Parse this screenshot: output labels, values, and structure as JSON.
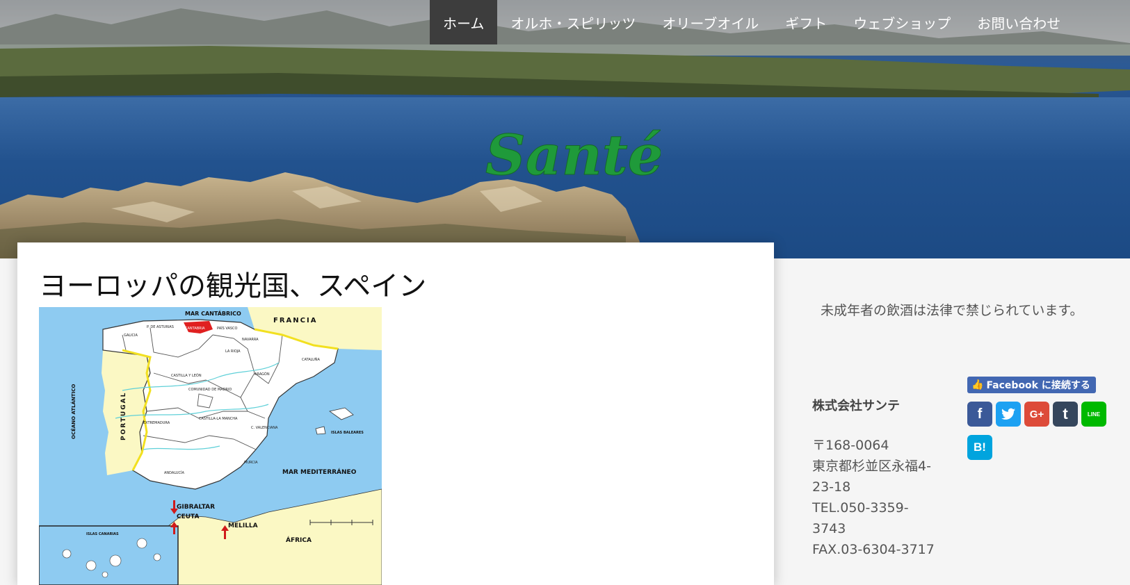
{
  "nav": {
    "items": [
      {
        "label": "ホーム",
        "active": true
      },
      {
        "label": "オルホ・スピリッツ",
        "active": false
      },
      {
        "label": "オリーブオイル",
        "active": false
      },
      {
        "label": "ギフト",
        "active": false
      },
      {
        "label": "ウェブショップ",
        "active": false
      },
      {
        "label": "お問い合わせ",
        "active": false
      }
    ]
  },
  "header": {
    "logo_text": "Santé",
    "logo_color": "#1f9a3a"
  },
  "article": {
    "title": "ヨーロッパの観光国、スペイン",
    "map_labels": {
      "sea_north": "MAR CANTÁBRICO",
      "france": "FRANCIA",
      "portugal": "PORTUGAL",
      "atlantic": "OCÉANO ATLÁNTICO",
      "mediterranean": "MAR MEDITERRÁNEO",
      "gibraltar": "GIBRALTAR",
      "ceuta": "CEUTA",
      "melilla": "MELILLA",
      "africa": "ÁFRICA",
      "canarias": "ISLAS CANARIAS",
      "baleares": "ISLAS BALEARES",
      "galicia": "GALICIA",
      "asturias": "P. DE ASTURIAS",
      "cantabria": "CANTABRIA",
      "pais_vasco": "PAÍS VASCO",
      "navarra": "NAVARRA",
      "la_rioja": "LA RIOJA",
      "cataluna": "CATALUÑA",
      "aragon": "ARAGÓN",
      "castilla_leon": "CASTILLA Y LEÓN",
      "madrid": "COMUNIDAD DE MADRID",
      "castilla_mancha": "CASTILLA-LA MANCHA",
      "extremadura": "EXTREMADURA",
      "valenciana": "C. VALENCIANA",
      "murcia": "MURCIA",
      "andalucia": "ANDALUCÍA"
    }
  },
  "sidebar": {
    "notice": "未成年者の飲酒は法律で禁じられています。",
    "company": "株式会社サンテ",
    "address_lines": [
      "〒168-0064",
      "東京都杉並区永福4-23-18",
      "TEL.050-3359-3743",
      "FAX.03-6304-3717"
    ],
    "fb_connect_label": "Facebook に接続する",
    "share_buttons": [
      {
        "name": "facebook",
        "glyph": "f",
        "color": "#3b5998"
      },
      {
        "name": "twitter",
        "glyph": "🐦",
        "color": "#1da1f2"
      },
      {
        "name": "google-plus",
        "glyph": "G+",
        "color": "#dd4b39"
      },
      {
        "name": "tumblr",
        "glyph": "t",
        "color": "#35465c"
      },
      {
        "name": "line",
        "glyph": "LINE",
        "color": "#00b900"
      },
      {
        "name": "hatena",
        "glyph": "B!",
        "color": "#00a4de"
      }
    ]
  }
}
